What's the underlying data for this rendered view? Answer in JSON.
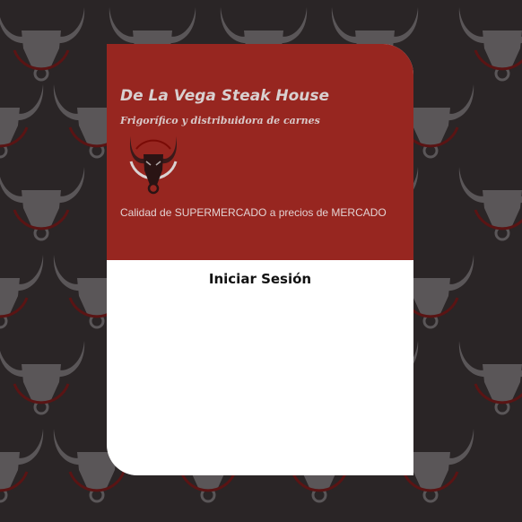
{
  "brand": {
    "name": "De La Vega Steak House",
    "subtitle": "Frigorífico y distribuidora de carnes",
    "tagline": "Calidad de SUPERMERCADO a precios de MERCADO",
    "logo_icon": "bull-head-icon"
  },
  "login": {
    "title": "Iniciar Sesión"
  },
  "background": {
    "pattern_icon": "bull-head-icon"
  },
  "colors": {
    "background": "#2a2526",
    "pattern": "#5a5658",
    "pattern_ring": "#5a1414",
    "header": "#8c0e08",
    "card": "#ffffff"
  }
}
